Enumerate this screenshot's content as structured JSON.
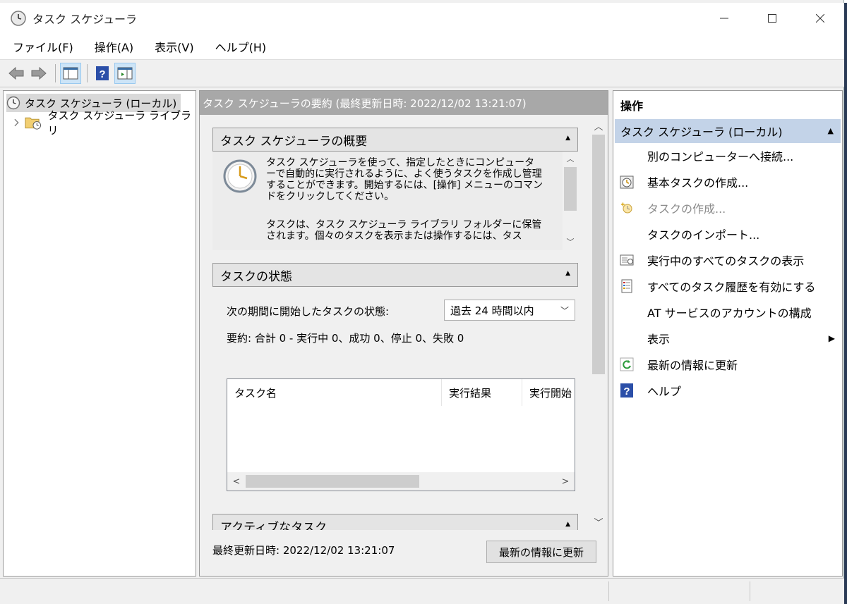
{
  "window": {
    "title": "タスク スケジューラ"
  },
  "menu": [
    "ファイル(F)",
    "操作(A)",
    "表示(V)",
    "ヘルプ(H)"
  ],
  "tree": {
    "root": "タスク スケジューラ (ローカル)",
    "child": "タスク スケジューラ ライブラリ"
  },
  "center": {
    "header": "タスク スケジューラの要約 (最終更新日時: 2022/12/02 13:21:07)",
    "overview": {
      "title": "タスク スケジューラの概要",
      "p1": "タスク スケジューラを使って、指定したときにコンピューターで自動的に実行されるように、よく使うタスクを作成し管理することができます。開始するには、[操作] メニューのコマンドをクリックしてください。",
      "p2": "タスクは、タスク スケジューラ ライブラリ フォルダーに保管されます。個々のタスクを表示または操作するには、タス"
    },
    "status": {
      "title": "タスクの状態",
      "period_label": "次の期間に開始したタスクの状態:",
      "period_value": "過去 24 時間以内",
      "summary": "要約: 合計 0 - 実行中 0、成功 0、停止 0、失敗 0",
      "columns": [
        "タスク名",
        "実行結果",
        "実行開始"
      ]
    },
    "active": {
      "title": "アクティブなタスク"
    },
    "footer_text": "最終更新日時: 2022/12/02 13:21:07",
    "refresh_button": "最新の情報に更新"
  },
  "actions": {
    "title": "操作",
    "group": "タスク スケジューラ (ローカル)",
    "items": [
      "別のコンピューターへ接続...",
      "基本タスクの作成...",
      "タスクの作成...",
      "タスクのインポート...",
      "実行中のすべてのタスクの表示",
      "すべてのタスク履歴を有効にする",
      "AT サービスのアカウントの構成",
      "表示",
      "最新の情報に更新",
      "ヘルプ"
    ]
  }
}
